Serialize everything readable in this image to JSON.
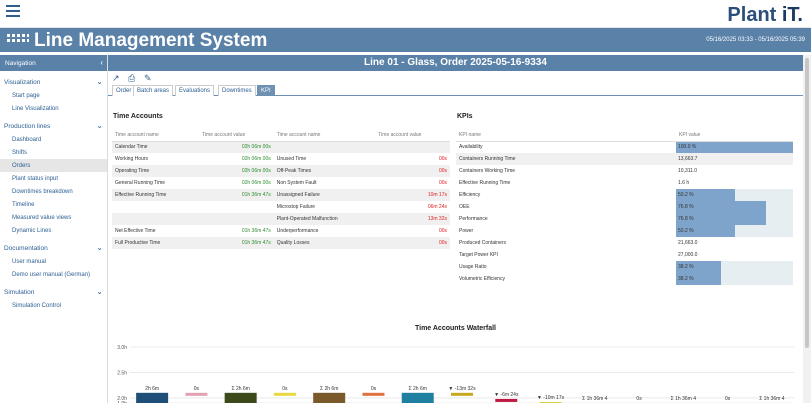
{
  "topbar": {
    "menu_icon": "hamburger-icon",
    "logo_text": "Plant ",
    "logo_accent": "iT."
  },
  "header": {
    "title": "Line Management System",
    "range": "05/16/2025 03:33 - 05/16/2025 05:39",
    "icon": "line-grid-icon"
  },
  "sidebar": {
    "title": "Navigation",
    "collapse_icon": "chevron-left-icon",
    "sections": [
      {
        "label": "Visualization",
        "items": [
          "Start page",
          "Line Visualization"
        ]
      },
      {
        "label": "Production lines",
        "items": [
          "Dashboard",
          "Shifts",
          "Orders",
          "Plant status input",
          "Downtimes breakdown",
          "Timeline",
          "Measured value views",
          "Dynamic Lines"
        ]
      },
      {
        "label": "Documentation",
        "items": [
          "User manual",
          "Demo user manual (German)"
        ]
      },
      {
        "label": "Simulation",
        "items": [
          "Simulation Control"
        ]
      }
    ],
    "active_item": "Orders"
  },
  "main": {
    "title": "Line 01 - Glass, Order 2025-05-16-9334",
    "toolbar": {
      "chart_icon": "chart-icon",
      "print_icon": "print-icon",
      "edit_icon": "pencil-icon"
    },
    "tabs": [
      "Order",
      "Batch areas",
      "Evaluations",
      "Downtimes",
      "KPI"
    ],
    "selected_tab": "KPI"
  },
  "time_accounts": {
    "title": "Time Accounts",
    "headers": [
      "Time account name",
      "Time account value",
      "Time account name",
      "Time account value"
    ],
    "rows": [
      [
        "Calendar Time",
        "02h 06m 00s",
        "",
        ""
      ],
      [
        "Working Hours",
        "02h 06m 00s",
        "Unused Time",
        "00s"
      ],
      [
        "Operating Time",
        "02h 06m 00s",
        "Off-Peak Times",
        "00s"
      ],
      [
        "General Running Time",
        "02h 06m 00s",
        "Non System Fault",
        "00s"
      ],
      [
        "Effective Running Time",
        "01h 36m 47s",
        "Unassigned Failure",
        "10m 17s"
      ],
      [
        "",
        "",
        "Microstop Failure",
        "06m 24s"
      ],
      [
        "",
        "",
        "Plant-Operated Malfunction",
        "13m 32s"
      ],
      [
        "Net Effective Time",
        "01h 36m 47s",
        "Underperformance",
        "00s"
      ],
      [
        "Full Productive Time",
        "01h 36m 47s",
        "Quality Losses",
        "00s"
      ]
    ]
  },
  "kpis": {
    "title": "KPIs",
    "headers": [
      "KPI name",
      "KPI value"
    ],
    "rows": [
      {
        "name": "Availability",
        "value": "100.0 %",
        "fill": 1.0,
        "shade": false
      },
      {
        "name": "Containers Running Time",
        "value": "13,663.7",
        "fill": 0,
        "shade": true
      },
      {
        "name": "Containers Working Time",
        "value": "10,311.0",
        "fill": 0,
        "shade": false
      },
      {
        "name": "Effective Running Time",
        "value": "1.6 h",
        "fill": 0,
        "shade": false
      },
      {
        "name": "Efficiency",
        "value": "50.2 %",
        "fill": 0.502,
        "shade": false
      },
      {
        "name": "OEE",
        "value": "76.8 %",
        "fill": 0.768,
        "shade": false
      },
      {
        "name": "Performance",
        "value": "76.8 %",
        "fill": 0.768,
        "shade": false
      },
      {
        "name": "Power",
        "value": "50.2 %",
        "fill": 0.502,
        "shade": false
      },
      {
        "name": "Produced Containers",
        "value": "21,663.0",
        "fill": 0,
        "shade": false
      },
      {
        "name": "Target Power KPI",
        "value": "27,000.0",
        "fill": 0,
        "shade": false
      },
      {
        "name": "Usage Ratio",
        "value": "38.2 %",
        "fill": 0.382,
        "shade": false
      },
      {
        "name": "Volumetric Efficiency",
        "value": "38.2 %",
        "fill": 0.382,
        "shade": false
      }
    ]
  },
  "chart_data": {
    "type": "bar",
    "title": "Time Accounts Waterfall",
    "ylim": [
      1.9,
      3.0
    ],
    "yticks": [
      "3.0h",
      "2.5h",
      "2.0h",
      "1.9h"
    ],
    "bars": [
      {
        "label": "2h 6m",
        "value": 2.1,
        "color": "#1f4e79"
      },
      {
        "label": "0s",
        "value": 2.1,
        "color": "#e2a0b0"
      },
      {
        "label": "Σ 2h 6m",
        "value": 2.1,
        "color": "#3b4a1a"
      },
      {
        "label": "0s",
        "value": 2.1,
        "color": "#e8d840"
      },
      {
        "label": "Σ 2h 6m",
        "value": 2.1,
        "color": "#7a5a2a"
      },
      {
        "label": "0s",
        "value": 2.1,
        "color": "#e07040"
      },
      {
        "label": "Σ 2h 6m",
        "value": 2.1,
        "color": "#1f7fa0"
      },
      {
        "label": "▼ -13m 32s",
        "value": 2.1,
        "color": "#c8a820"
      },
      {
        "label": "▼ -6m 24s",
        "value": 1.98,
        "color": "#c01840"
      },
      {
        "label": "▼ -10m 17s",
        "value": 1.92,
        "color": "#d8d040"
      },
      {
        "label": "Σ 1h 36m 4",
        "value": 1.9,
        "color": "#506090"
      },
      {
        "label": "0s",
        "value": 1.9,
        "color": "#b03030"
      },
      {
        "label": "Σ 1h 36m 4",
        "value": 1.9,
        "color": "#708060"
      },
      {
        "label": "0s",
        "value": 1.9,
        "color": "#a0a0a0"
      },
      {
        "label": "Σ 1h 36m 4",
        "value": 1.9,
        "color": "#90a050"
      }
    ]
  }
}
